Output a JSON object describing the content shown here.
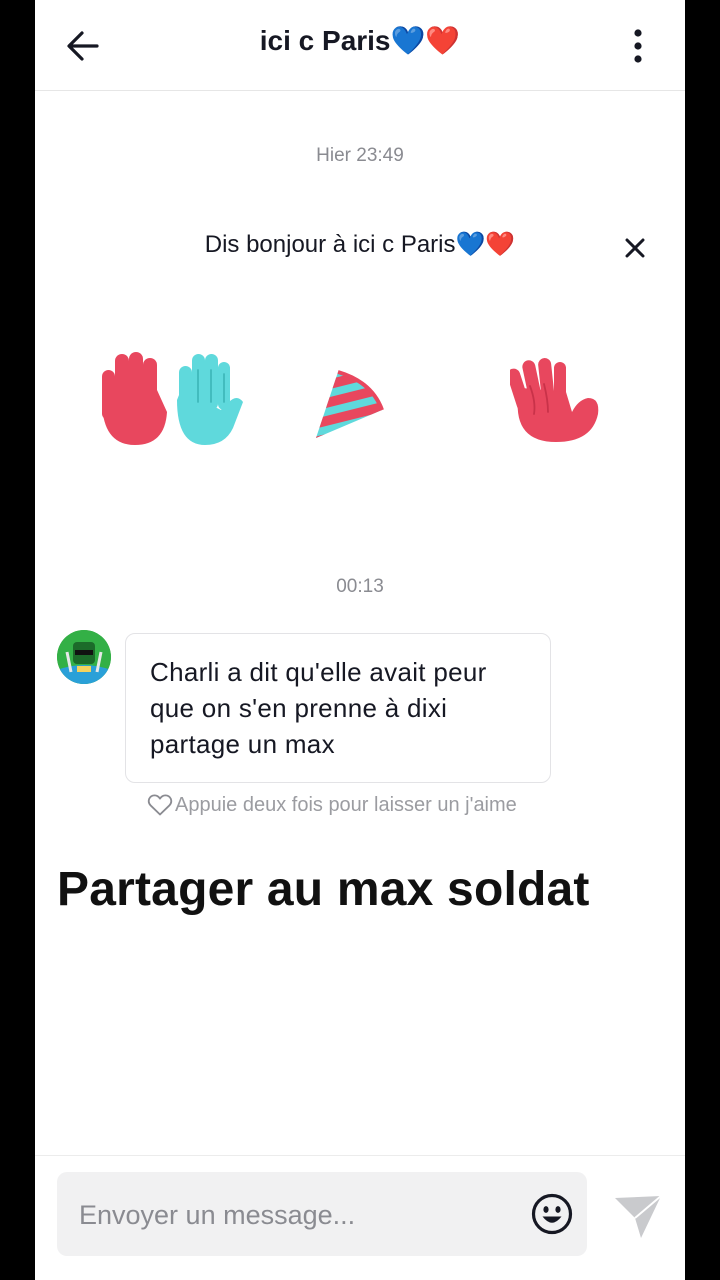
{
  "header": {
    "title": "ici c Paris💙❤️",
    "back_icon": "arrow-left-icon",
    "menu_icon": "more-vertical-icon"
  },
  "conversation": {
    "timestamp_1": "Hier 23:49",
    "greeting": "Dis bonjour à ici c Paris💙❤️",
    "stickers": [
      "raised-hands-sticker",
      "party-hat-sticker",
      "waving-hand-sticker"
    ],
    "timestamp_2": "00:13",
    "messages": [
      {
        "sender_avatar": "avatar",
        "text": "Charli a dit qu'elle avait peur que on s'en prenne à dixi partage un max"
      }
    ],
    "like_hint": "Appuie deux fois pour laisser un j'aime"
  },
  "caption": "Partager au max soldat",
  "composer": {
    "placeholder": "Envoyer un message...",
    "emoji_icon": "emoji-icon",
    "send_icon": "send-icon"
  },
  "colors": {
    "accent_red": "#e8475e",
    "accent_cyan": "#5fd9dc",
    "text_primary": "#161823",
    "text_secondary": "#8a8b91"
  }
}
